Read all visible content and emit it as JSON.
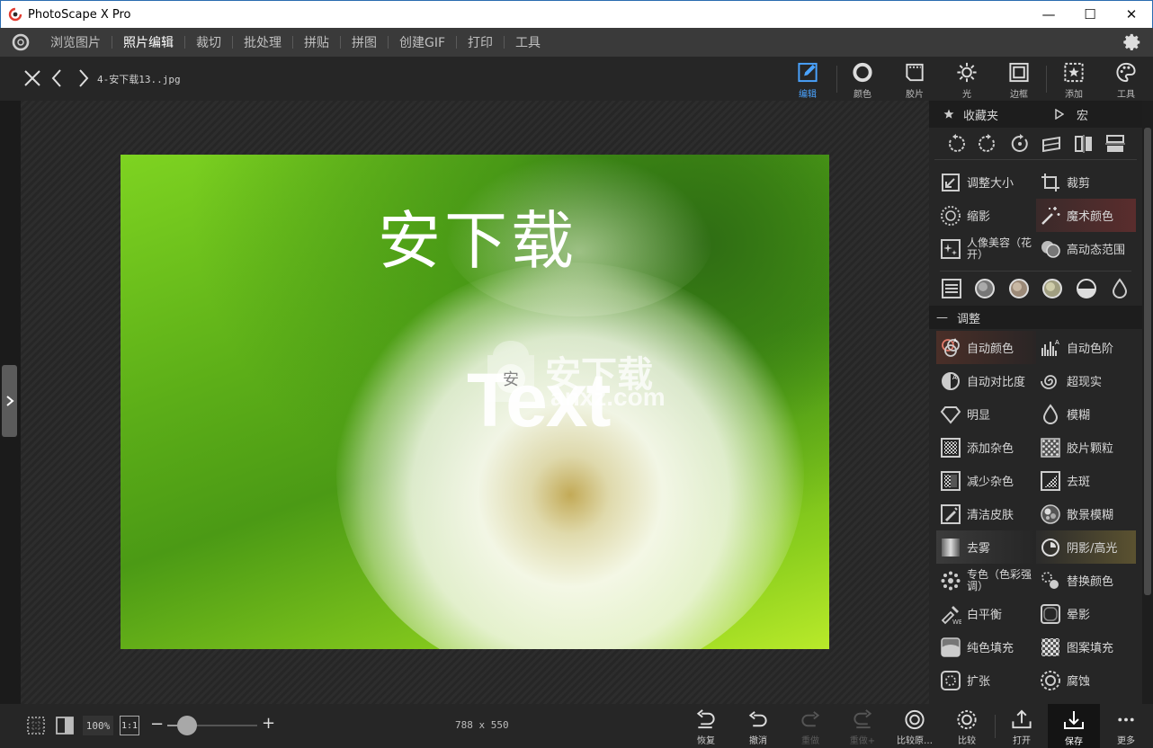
{
  "window": {
    "title": "PhotoScape X Pro",
    "controls": [
      "—",
      "☐",
      "✕"
    ]
  },
  "menu": {
    "items": [
      {
        "label": "浏览图片",
        "active": false
      },
      {
        "label": "照片编辑",
        "active": true
      },
      {
        "label": "裁切",
        "active": false
      },
      {
        "label": "批处理",
        "active": false
      },
      {
        "label": "拼贴",
        "active": false
      },
      {
        "label": "拼图",
        "active": false
      },
      {
        "label": "创建GIF",
        "active": false
      },
      {
        "label": "打印",
        "active": false
      },
      {
        "label": "工具",
        "active": false
      }
    ]
  },
  "toolbar": {
    "filename": "4-安下载13..jpg",
    "tabs": [
      {
        "label": "编辑",
        "icon": "edit-pencil-icon",
        "active": true
      },
      {
        "label": "颜色",
        "icon": "color-circle-icon"
      },
      {
        "label": "胶片",
        "icon": "film-icon"
      },
      {
        "label": "光",
        "icon": "sun-icon"
      },
      {
        "label": "边框",
        "icon": "frame-icon"
      },
      {
        "label": "添加",
        "icon": "add-star-icon"
      },
      {
        "label": "工具",
        "icon": "palette-icon"
      }
    ]
  },
  "photo": {
    "watermark_big": "安下载",
    "watermark_text": "Text",
    "watermark_cn": "安下载",
    "watermark_url": "anxz.com",
    "logo_char": "安"
  },
  "panel": {
    "favorites_label": "收藏夹",
    "macro_label": "宏",
    "tools_top": [
      {
        "label": "调整大小",
        "icon": "resize-icon"
      },
      {
        "label": "裁剪",
        "icon": "crop-icon"
      },
      {
        "label": "缩影",
        "icon": "vignette-icon"
      },
      {
        "label": "魔术颜色",
        "icon": "magic-wand-icon",
        "highlight": "red"
      },
      {
        "label": "人像美容（花开）",
        "icon": "portrait-sparkle-icon"
      },
      {
        "label": "高动态范围",
        "icon": "hdr-icon"
      }
    ],
    "section_adjust": "调整",
    "tools_adjust": [
      {
        "label": "自动颜色",
        "icon": "auto-color-icon",
        "highlight": "brown"
      },
      {
        "label": "自动色阶",
        "icon": "auto-levels-icon"
      },
      {
        "label": "自动对比度",
        "icon": "auto-contrast-icon"
      },
      {
        "label": "超现实",
        "icon": "surreal-swirl-icon"
      },
      {
        "label": "明显",
        "icon": "diamond-icon"
      },
      {
        "label": "模糊",
        "icon": "blur-drop-icon"
      },
      {
        "label": "添加杂色",
        "icon": "add-noise-icon"
      },
      {
        "label": "胶片颗粒",
        "icon": "film-grain-icon"
      },
      {
        "label": "减少杂色",
        "icon": "reduce-noise-icon"
      },
      {
        "label": "去斑",
        "icon": "despeckle-icon"
      },
      {
        "label": "清洁皮肤",
        "icon": "clean-skin-icon"
      },
      {
        "label": "散景模糊",
        "icon": "bokeh-icon"
      },
      {
        "label": "去雾",
        "icon": "dehaze-icon",
        "highlight": "gray"
      },
      {
        "label": "阴影/高光",
        "icon": "shadow-highlight-icon",
        "highlight": "yellow"
      },
      {
        "label": "专色（色彩强调）",
        "icon": "color-splash-icon"
      },
      {
        "label": "替换颜色",
        "icon": "replace-color-icon"
      },
      {
        "label": "白平衡",
        "icon": "white-balance-icon"
      },
      {
        "label": "晕影",
        "icon": "vignette-frame-icon"
      },
      {
        "label": "纯色填充",
        "icon": "solid-fill-icon"
      },
      {
        "label": "图案填充",
        "icon": "pattern-fill-icon"
      },
      {
        "label": "扩张",
        "icon": "dilate-icon"
      },
      {
        "label": "腐蚀",
        "icon": "erode-icon"
      }
    ]
  },
  "bottom": {
    "zoom": "100%",
    "one_to_one": "1:1",
    "dimensions": "788 x 550",
    "buttons": [
      {
        "label": "恢复",
        "icon": "revert-icon",
        "enabled": true
      },
      {
        "label": "撤消",
        "icon": "undo-icon",
        "enabled": true
      },
      {
        "label": "重做",
        "icon": "redo-icon",
        "enabled": false
      },
      {
        "label": "重做+",
        "icon": "redo-all-icon",
        "enabled": false
      },
      {
        "label": "比较原…",
        "icon": "compare-original-icon",
        "enabled": true
      },
      {
        "label": "比较",
        "icon": "compare-icon",
        "enabled": true
      },
      {
        "label": "打开",
        "icon": "open-icon",
        "enabled": true
      },
      {
        "label": "保存",
        "icon": "save-icon",
        "enabled": true
      },
      {
        "label": "更多",
        "icon": "more-icon",
        "enabled": true
      }
    ]
  }
}
